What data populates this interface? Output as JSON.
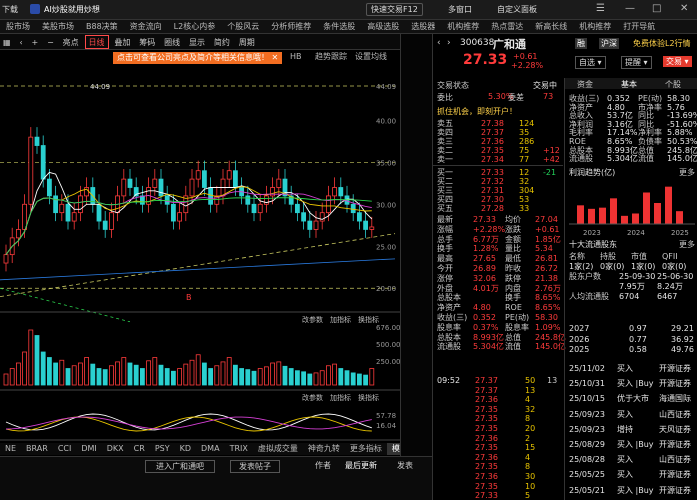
{
  "top": {
    "download": "下载",
    "ai": "AI炒股就用炒想",
    "quick_trade": "快速交易F12",
    "multi_window": "多窗口",
    "customize": "自定义面板"
  },
  "nav": [
    "股市场",
    "美股市场",
    "B88决策",
    "资金流向",
    "L2核心内参",
    "个股风云",
    "分析师推荐",
    "条件选股",
    "高级选股",
    "选股器",
    "机构推荐",
    "热点雷达",
    "新高长线",
    "机构推荐",
    "打开导航"
  ],
  "toolbar": {
    "highlight": "亮点",
    "day": "日线",
    "overlay": "叠加",
    "chip": "筹码",
    "circle": "圈线",
    "display": "显示",
    "simplify": "简约",
    "period": "周期"
  },
  "chart_tabs": [
    "HB",
    "趋势跟踪",
    "设置均线"
  ],
  "banner": "点击可查看公司亮点及简介等相关信息哦！",
  "price_labels": [
    "44.09",
    "40.00",
    "35.00",
    "30.00",
    "25.00",
    "20.00"
  ],
  "hi_label": "44.09",
  "vol_labels": [
    "676.00",
    "500.00",
    "250.00"
  ],
  "macd_labels": [
    "57.78",
    "16.04"
  ],
  "vol_tabs": [
    "改参数",
    "加指标",
    "换指标"
  ],
  "macd_tabs": [
    "改参数",
    "加指标",
    "换指标"
  ],
  "x_labels": [
    "12",
    "2025",
    "02",
    "03",
    "04",
    "05",
    "06",
    "07",
    "08",
    "09",
    "10",
    "11",
    "12",
    "2026/01/16/五"
  ],
  "indicators": [
    "NE",
    "BRAR",
    "CCI",
    "DMI",
    "DKX",
    "CR",
    "PSY",
    "KD",
    "DMA",
    "TRIX",
    "虚拟成交量",
    "神奇九转",
    "更多指标",
    "模板"
  ],
  "stock": {
    "code": "300638",
    "name": "广和通",
    "price": "27.33",
    "change": "+0.61",
    "pct": "+2.28%",
    "tag1": "融",
    "tag2": "沪深",
    "label1": "免费体验L2行情",
    "btn_self": "自选",
    "btn_alert": "提醒",
    "btn_trade": "交易"
  },
  "tabs": [
    "资金",
    "基本",
    "个股"
  ],
  "order": {
    "status": "交易状态",
    "trading": "交易中",
    "webi_label": "委比",
    "webi": "5.30%",
    "weichai_label": "委差",
    "weichai": "73",
    "ad": "抓住机会，即刻开户！",
    "sells": [
      [
        "卖五",
        "27.38",
        "124",
        ""
      ],
      [
        "卖四",
        "27.37",
        "35",
        ""
      ],
      [
        "卖三",
        "27.36",
        "286",
        ""
      ],
      [
        "卖二",
        "27.35",
        "75",
        "+12"
      ],
      [
        "卖一",
        "27.34",
        "77",
        "+42"
      ]
    ],
    "buys": [
      [
        "买一",
        "27.33",
        "12",
        "-21"
      ],
      [
        "买二",
        "27.32",
        "32",
        ""
      ],
      [
        "买三",
        "27.31",
        "304",
        ""
      ],
      [
        "买四",
        "27.30",
        "53",
        ""
      ],
      [
        "买五",
        "27.28",
        "33",
        ""
      ]
    ]
  },
  "fund_stats": [
    [
      "收益(三)",
      "0.352",
      "PE(动)",
      "58.30"
    ],
    [
      "净资产",
      "4.80",
      "市净率",
      "5.76"
    ],
    [
      "总收入",
      "53.7亿",
      "同比",
      "-13.69%"
    ],
    [
      "净利润",
      "3.16亿",
      "同比",
      "-51.60%"
    ],
    [
      "毛利率",
      "17.14%",
      "净利率",
      "5.88%"
    ],
    [
      "ROE",
      "8.65%",
      "负债率",
      "50.53%"
    ],
    [
      "总股本",
      "8.993亿",
      "总值",
      "245.8亿"
    ],
    [
      "流通股",
      "5.304亿",
      "流值",
      "145.0亿"
    ]
  ],
  "profit_title": "利润趋势(亿)",
  "profit_more": "更多",
  "profit_years": [
    "2023",
    "2024",
    "2025"
  ],
  "profit_values": [
    0.8,
    0.65,
    0.7,
    1.1,
    0.35,
    0.45,
    1.35,
    0.9,
    1.6,
    0.55
  ],
  "quote": [
    [
      "最新",
      "27.33",
      "均价",
      "27.04"
    ],
    [
      "涨幅",
      "+2.28%",
      "涨跌",
      "+0.61"
    ],
    [
      "总手",
      "6.77万",
      "金额",
      "1.85亿"
    ],
    [
      "换手",
      "1.28%",
      "量比",
      "5.34"
    ],
    [
      "最高",
      "27.65",
      "最低",
      "26.81"
    ],
    [
      "今开",
      "26.89",
      "昨收",
      "26.72"
    ],
    [
      "涨停",
      "32.06",
      "跌停",
      "21.38"
    ],
    [
      "外盘",
      "4.01万",
      "内盘",
      "2.76万"
    ],
    [
      "总股本",
      "",
      "换手",
      "8.65%"
    ],
    [
      "净资产",
      "4.80",
      "ROE",
      "8.65%"
    ],
    [
      "收益(三)",
      "0.352",
      "PE(动)",
      "58.30"
    ],
    [
      "股息率",
      "0.37%",
      "股息率",
      "1.09%"
    ],
    [
      "总股本",
      "8.993亿",
      "总值",
      "245.8亿"
    ],
    [
      "流通股",
      "5.304亿",
      "流值",
      "145.0亿"
    ]
  ],
  "holders_title": "十大流通股东",
  "holders_more": "更多",
  "holders_head": [
    "名称",
    "持股",
    "市值",
    "QFII"
  ],
  "holders_sub": [
    "1家(2)",
    "0家(0)",
    "1家(0)",
    "0家(0)"
  ],
  "holder_rows": [
    [
      "股东户数",
      "25-09-30",
      "25-06-30"
    ],
    [
      "",
      "7.95万",
      "8.24万"
    ],
    [
      "人均流通股",
      "6704",
      "6467"
    ]
  ],
  "dividend": [
    [
      "2027",
      "0.97",
      "29.21"
    ],
    [
      "2026",
      "0.77",
      "36.92"
    ],
    [
      "2025",
      "0.58",
      "49.76"
    ]
  ],
  "ticks": [
    [
      "09:52",
      "27.37",
      "50",
      "13"
    ],
    [
      "",
      "27.37",
      "13",
      ""
    ],
    [
      "",
      "27.36",
      "4",
      ""
    ],
    [
      "",
      "27.35",
      "32",
      ""
    ],
    [
      "",
      "27.35",
      "8",
      ""
    ],
    [
      "",
      "27.35",
      "20",
      ""
    ],
    [
      "",
      "27.36",
      "2",
      ""
    ],
    [
      "",
      "27.35",
      "15",
      ""
    ],
    [
      "",
      "27.36",
      "4",
      ""
    ],
    [
      "",
      "27.35",
      "8",
      ""
    ],
    [
      "",
      "27.36",
      "30",
      ""
    ],
    [
      "",
      "27.35",
      "10",
      ""
    ],
    [
      "",
      "27.33",
      "5",
      ""
    ]
  ],
  "deals": [
    [
      "25/11/02",
      "买入",
      "开源证券"
    ],
    [
      "25/10/31",
      "买入 |Buy",
      "开源证券"
    ],
    [
      "25/10/15",
      "优于大市",
      "海通国际"
    ],
    [
      "25/09/23",
      "买入",
      "山西证券"
    ],
    [
      "25/09/23",
      "增持",
      "天风证券"
    ],
    [
      "25/08/29",
      "买入 |Buy",
      "开源证券"
    ],
    [
      "25/08/28",
      "买入",
      "山西证券"
    ],
    [
      "25/05/25",
      "买入",
      "开源证券"
    ],
    [
      "25/05/21",
      "买入 |Buy",
      "开源证券"
    ]
  ],
  "bottom": {
    "btn1": "进入广和通吧",
    "btn2": "发表帖子",
    "author": "作者",
    "latest": "最后更新",
    "publish": "发表"
  }
}
